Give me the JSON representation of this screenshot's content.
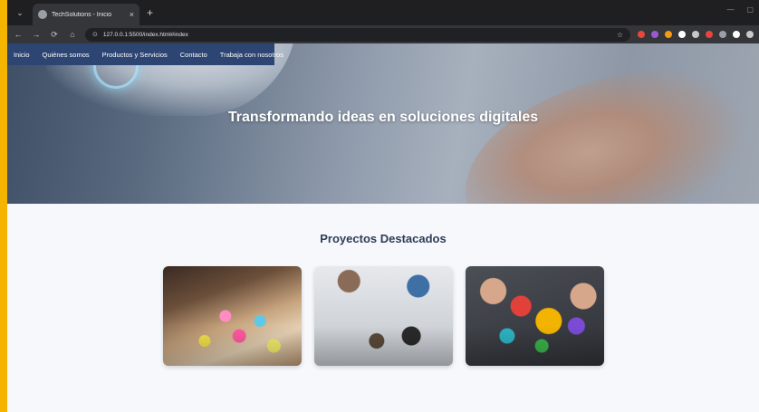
{
  "browser": {
    "tab_title": "TechSolutions - Inicio",
    "tab_close": "×",
    "new_tab": "+",
    "url": "127.0.0.1:5500/index.html#index",
    "tab_search_glyph": "⌄",
    "back_glyph": "←",
    "forward_glyph": "→",
    "reload_glyph": "⟳",
    "home_glyph": "⌂",
    "site_info_glyph": "⊙",
    "bookmark_glyph": "☆",
    "minimize_glyph": "—",
    "maximize_glyph": "▢",
    "extensions": [
      {
        "name": "extension-1-icon",
        "color": "#e8453c"
      },
      {
        "name": "extension-2-icon",
        "color": "#9b59d0"
      },
      {
        "name": "extension-3-icon",
        "color": "#f39c12"
      },
      {
        "name": "extension-4-icon",
        "color": "#ffffff"
      },
      {
        "name": "extension-5-icon",
        "color": "#c8c8c8"
      },
      {
        "name": "extension-6-icon",
        "color": "#e8453c"
      },
      {
        "name": "extension-7-icon",
        "color": "#9aa0a6"
      },
      {
        "name": "extension-8-icon",
        "color": "#ffffff"
      },
      {
        "name": "extension-9-icon",
        "color": "#c8c8c8"
      }
    ]
  },
  "site_nav": {
    "items": [
      {
        "label": "Inicio"
      },
      {
        "label": "Quiénes somos"
      },
      {
        "label": "Productos y Servicios"
      },
      {
        "label": "Contacto"
      },
      {
        "label": "Trabaja con nosotros"
      }
    ]
  },
  "hero": {
    "title": "Transformando ideas en soluciones digitales"
  },
  "projects": {
    "title": "Proyectos Destacados"
  },
  "colors": {
    "nav_bg": "#2d4573",
    "heading": "#2f3d57",
    "window_border": "#f4b400"
  }
}
